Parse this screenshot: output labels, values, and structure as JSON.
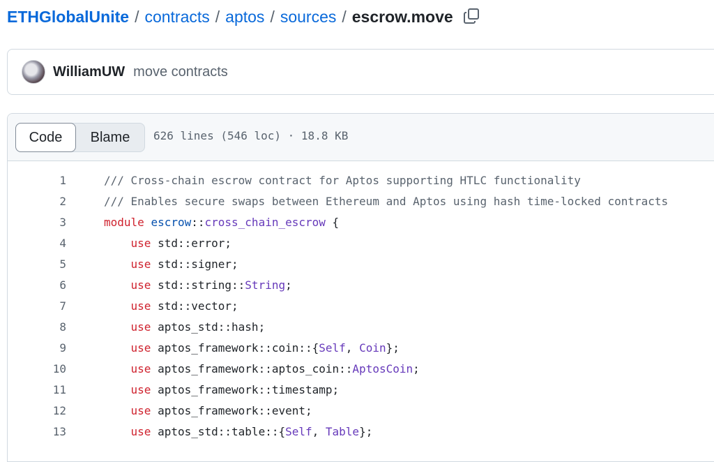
{
  "breadcrumb": {
    "root": "ETHGlobalUnite",
    "items": [
      "contracts",
      "aptos",
      "sources"
    ],
    "current": "escrow.move",
    "separator": "/"
  },
  "icons": {
    "copy": "copy-icon",
    "avatar": "avatar"
  },
  "commit": {
    "author": "WilliamUW",
    "message": "move contracts"
  },
  "file": {
    "tabs": {
      "code": "Code",
      "blame": "Blame"
    },
    "meta": "626 lines (546 loc) · 18.8 KB"
  },
  "colors": {
    "link": "#0969da",
    "keyword": "#cf222e",
    "entity": "#6639ba",
    "module": "#0550ae",
    "comment": "#59636e"
  },
  "code_lines": [
    {
      "num": "1",
      "tokens": [
        [
          "comment",
          "/// Cross-chain escrow contract for Aptos supporting HTLC functionality"
        ]
      ]
    },
    {
      "num": "2",
      "tokens": [
        [
          "comment",
          "/// Enables secure swaps between Ethereum and Aptos using hash time-locked contracts"
        ]
      ]
    },
    {
      "num": "3",
      "tokens": [
        [
          "kw",
          "module "
        ],
        [
          "mod",
          "escrow"
        ],
        [
          "plain",
          "::"
        ],
        [
          "ent",
          "cross_chain_escrow"
        ],
        [
          "plain",
          " {"
        ]
      ]
    },
    {
      "num": "4",
      "tokens": [
        [
          "plain",
          "    "
        ],
        [
          "kw",
          "use"
        ],
        [
          "plain",
          " std::error;"
        ]
      ]
    },
    {
      "num": "5",
      "tokens": [
        [
          "plain",
          "    "
        ],
        [
          "kw",
          "use"
        ],
        [
          "plain",
          " std::signer;"
        ]
      ]
    },
    {
      "num": "6",
      "tokens": [
        [
          "plain",
          "    "
        ],
        [
          "kw",
          "use"
        ],
        [
          "plain",
          " std::string::"
        ],
        [
          "ent",
          "String"
        ],
        [
          "plain",
          ";"
        ]
      ]
    },
    {
      "num": "7",
      "tokens": [
        [
          "plain",
          "    "
        ],
        [
          "kw",
          "use"
        ],
        [
          "plain",
          " std::vector;"
        ]
      ]
    },
    {
      "num": "8",
      "tokens": [
        [
          "plain",
          "    "
        ],
        [
          "kw",
          "use"
        ],
        [
          "plain",
          " aptos_std::hash;"
        ]
      ]
    },
    {
      "num": "9",
      "tokens": [
        [
          "plain",
          "    "
        ],
        [
          "kw",
          "use"
        ],
        [
          "plain",
          " aptos_framework::coin::{"
        ],
        [
          "ent",
          "Self"
        ],
        [
          "plain",
          ", "
        ],
        [
          "ent",
          "Coin"
        ],
        [
          "plain",
          "};"
        ]
      ]
    },
    {
      "num": "10",
      "tokens": [
        [
          "plain",
          "    "
        ],
        [
          "kw",
          "use"
        ],
        [
          "plain",
          " aptos_framework::aptos_coin::"
        ],
        [
          "ent",
          "AptosCoin"
        ],
        [
          "plain",
          ";"
        ]
      ]
    },
    {
      "num": "11",
      "tokens": [
        [
          "plain",
          "    "
        ],
        [
          "kw",
          "use"
        ],
        [
          "plain",
          " aptos_framework::timestamp;"
        ]
      ]
    },
    {
      "num": "12",
      "tokens": [
        [
          "plain",
          "    "
        ],
        [
          "kw",
          "use"
        ],
        [
          "plain",
          " aptos_framework::event;"
        ]
      ]
    },
    {
      "num": "13",
      "tokens": [
        [
          "plain",
          "    "
        ],
        [
          "kw",
          "use"
        ],
        [
          "plain",
          " aptos_std::table::{"
        ],
        [
          "ent",
          "Self"
        ],
        [
          "plain",
          ", "
        ],
        [
          "ent",
          "Table"
        ],
        [
          "plain",
          "};"
        ]
      ]
    }
  ]
}
